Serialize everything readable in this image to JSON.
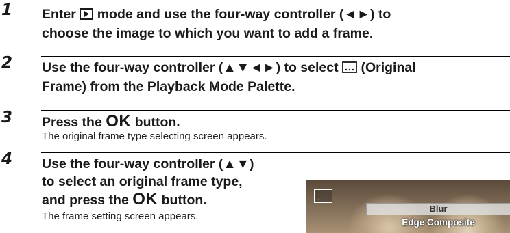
{
  "steps": [
    {
      "number": "1",
      "title_part1": "Enter",
      "title_part2": "mode and use the four-way controller (◄►) to",
      "title_line2": "choose the image to which you want to add a frame.",
      "icon": "playback-icon"
    },
    {
      "number": "2",
      "title_part1": "Use the four-way controller (▲▼◄►) to select",
      "title_part2": "(Original",
      "title_line2": "Frame) from the Playback Mode Palette.",
      "icon": "original-frame-icon"
    },
    {
      "number": "3",
      "title_part1": "Press the",
      "ok": "OK",
      "title_part2": "button.",
      "description": "The original frame type selecting screen appears."
    },
    {
      "number": "4",
      "line1": "Use the four-way controller (▲▼)",
      "line2": "to select an original frame type,",
      "line3_part1": "and press the",
      "ok": "OK",
      "line3_part2": "button.",
      "description": "The frame setting screen appears."
    }
  ],
  "screen": {
    "menu_items": [
      "Blur",
      "Edge Composite"
    ],
    "frame_icon_glyph": "..."
  }
}
